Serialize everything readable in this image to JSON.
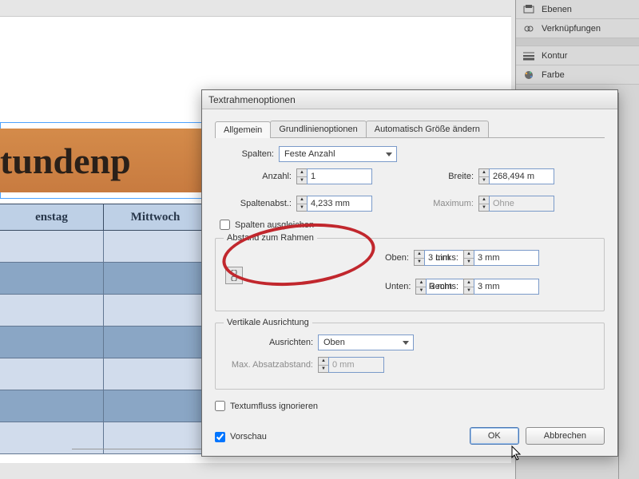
{
  "panels": {
    "ebenen": "Ebenen",
    "verknuepfungen": "Verknüpfungen",
    "kontur": "Kontur",
    "farbe": "Farbe"
  },
  "canvas": {
    "title_fragment": "tundenp",
    "day1": "enstag",
    "day2": "Mittwoch"
  },
  "dialog": {
    "title": "Textrahmenoptionen",
    "tabs": {
      "general": "Allgemein",
      "baseline": "Grundlinienoptionen",
      "autosize": "Automatisch Größe ändern"
    },
    "columns_label": "Spalten:",
    "columns_mode": "Feste Anzahl",
    "count_label": "Anzahl:",
    "count_value": "1",
    "width_label": "Breite:",
    "width_value": "268,494 m",
    "gap_label": "Spaltenabst.:",
    "gap_value": "4,233 mm",
    "max_label": "Maximum:",
    "max_value": "Ohne",
    "balance_label": "Spalten ausgleichen",
    "inset_legend": "Abstand zum Rahmen",
    "top_label": "Oben:",
    "top_value": "3 mm",
    "links_label": "Links:",
    "links_value": "3 mm",
    "bottom_label": "Unten:",
    "bottom_value": "3 mm",
    "right_label": "Rechts:",
    "right_value": "3 mm",
    "vj_legend": "Vertikale Ausrichtung",
    "align_label": "Ausrichten:",
    "align_value": "Oben",
    "para_label": "Max. Absatzabstand:",
    "para_value": "0 mm",
    "ignore_wrap": "Textumfluss ignorieren",
    "preview": "Vorschau",
    "ok": "OK",
    "cancel": "Abbrechen"
  }
}
